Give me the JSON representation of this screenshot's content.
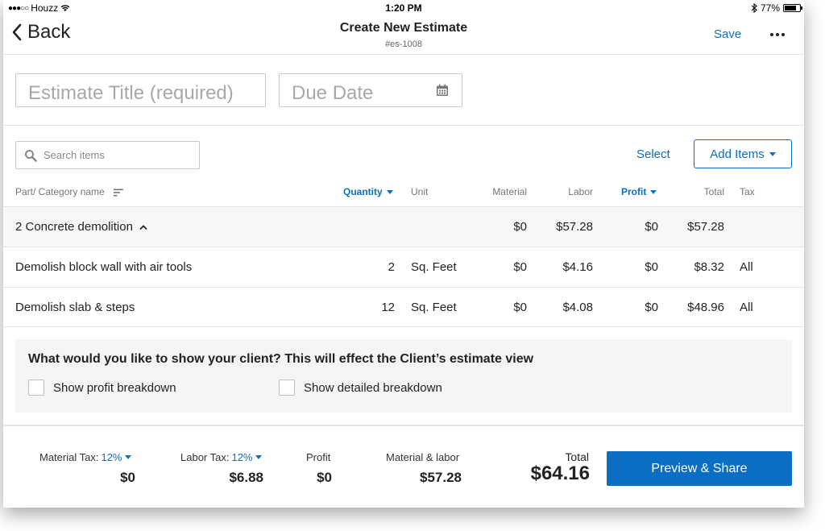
{
  "status_bar": {
    "carrier": "Houzz",
    "time": "1:20 PM",
    "battery": "77%",
    "battery_level": 0.77
  },
  "nav": {
    "back_label": "Back",
    "title": "Create New Estimate",
    "subtitle": "#es-1008",
    "save_label": "Save"
  },
  "form": {
    "title_placeholder": "Estimate Title (required)",
    "due_date_placeholder": "Due Date"
  },
  "toolbar": {
    "search_placeholder": "Search items",
    "select_label": "Select",
    "add_items_label": "Add Items"
  },
  "table": {
    "headers": {
      "name": "Part/ Category name",
      "quantity": "Quantity",
      "unit": "Unit",
      "material": "Material",
      "labor": "Labor",
      "profit": "Profit",
      "total": "Total",
      "tax": "Tax"
    },
    "group": {
      "name": "2 Concrete demolition",
      "material": "$0",
      "labor": "$57.28",
      "profit": "$0",
      "total": "$57.28"
    },
    "rows": [
      {
        "name": "Demolish block wall with air tools",
        "quantity": "2",
        "unit": "Sq. Feet",
        "material": "$0",
        "labor": "$4.16",
        "profit": "$0",
        "total": "$8.32",
        "tax": "All"
      },
      {
        "name": "Demolish slab & steps",
        "quantity": "12",
        "unit": "Sq. Feet",
        "material": "$0",
        "labor": "$4.08",
        "profit": "$0",
        "total": "$48.96",
        "tax": "All"
      }
    ]
  },
  "client_view": {
    "question": "What would you like to show your client? This will effect the Client’s estimate view",
    "show_profit_label": "Show profit breakdown",
    "show_detailed_label": "Show detailed breakdown"
  },
  "footer": {
    "material_tax_label": "Material Tax:",
    "material_tax_rate": "12%",
    "material_tax_value": "$0",
    "labor_tax_label": "Labor Tax:",
    "labor_tax_rate": "12%",
    "labor_tax_value": "$6.88",
    "profit_label": "Profit",
    "profit_value": "$0",
    "material_labor_label": "Material & labor",
    "material_labor_value": "$57.28",
    "total_label": "Total",
    "total_value": "$64.16",
    "preview_label": "Preview & Share"
  },
  "colors": {
    "accent": "#0a6fc2",
    "group_row_bg": "#f7f7f7",
    "panel_bg": "#f5f5f5"
  }
}
